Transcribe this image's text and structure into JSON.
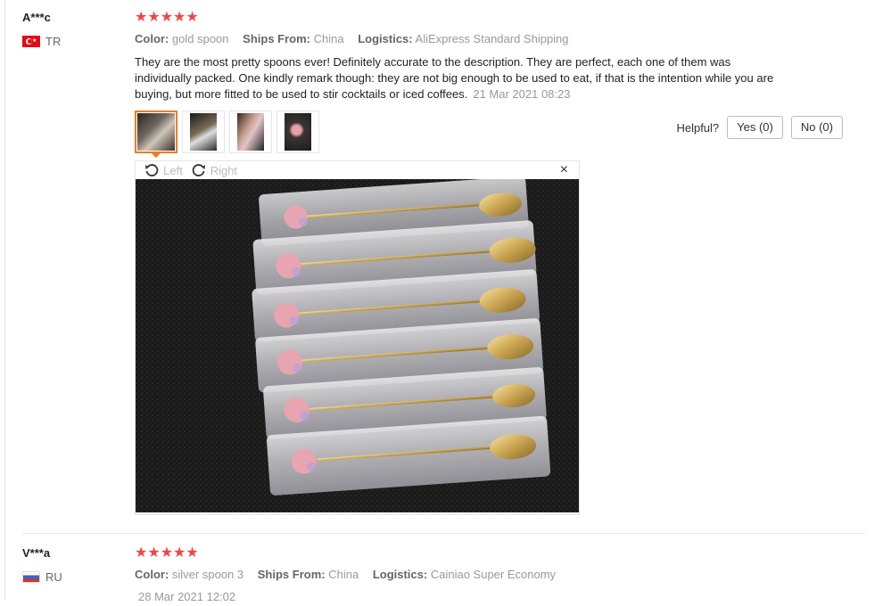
{
  "reviews": [
    {
      "user": "A***c",
      "country": "TR",
      "rating": 5,
      "color_label": "Color:",
      "color": "gold spoon",
      "ships_label": "Ships From:",
      "ships_from": "China",
      "logistics_label": "Logistics:",
      "logistics": "AliExpress Standard Shipping",
      "text": "They are the most pretty spoons ever! Definitely accurate to the description. They are perfect, each one of them was individually packed. One kindly remark though: they are not big enough to be used to eat, if that is the intention while you are buying, but more fitted to be used to stir cocktails or iced coffees.",
      "date": "21 Mar 2021 08:23",
      "helpful_label": "Helpful?",
      "yes_label": "Yes (0)",
      "no_label": "No (0)",
      "viewer": {
        "rotate_left": "Left",
        "rotate_right": "Right",
        "close": "×"
      }
    },
    {
      "user": "V***a",
      "country": "RU",
      "rating": 5,
      "color_label": "Color:",
      "color": "silver spoon 3",
      "ships_label": "Ships From:",
      "ships_from": "China",
      "logistics_label": "Logistics:",
      "logistics": "Cainiao Super Economy",
      "date": "28 Mar 2021 12:02"
    }
  ],
  "colors": {
    "star": "#ef4646",
    "active_thumb": "#f47b20"
  },
  "icons": [
    "star-icon",
    "rotate-left-icon",
    "rotate-right-icon",
    "close-icon",
    "flag-tr-icon",
    "flag-ru-icon"
  ]
}
